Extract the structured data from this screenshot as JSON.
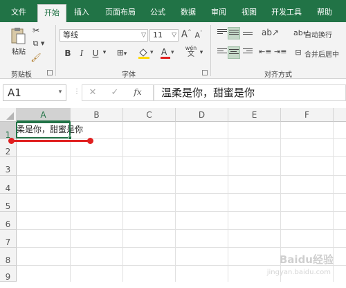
{
  "tabs": [
    {
      "label": "文件",
      "active": false
    },
    {
      "label": "开始",
      "active": true
    },
    {
      "label": "插入",
      "active": false
    },
    {
      "label": "页面布局",
      "active": false
    },
    {
      "label": "公式",
      "active": false
    },
    {
      "label": "数据",
      "active": false
    },
    {
      "label": "审阅",
      "active": false
    },
    {
      "label": "视图",
      "active": false
    },
    {
      "label": "开发工具",
      "active": false
    },
    {
      "label": "帮助",
      "active": false
    }
  ],
  "ribbon": {
    "clipboard": {
      "paste_label": "粘贴",
      "group_label": "剪贴板"
    },
    "font": {
      "font_name": "等线",
      "font_size": "11",
      "group_label": "字体",
      "bold": "B",
      "italic": "I",
      "underline": "U",
      "grow": "A",
      "shrink": "A",
      "phonetic_top": "wén",
      "phonetic_bottom": "文"
    },
    "alignment": {
      "wrap_text": "自动换行",
      "merge_center": "合并后居中",
      "group_label": "对齐方式"
    }
  },
  "formula_bar": {
    "name_box": "A1",
    "fx": "fx",
    "content": "温柔是你，甜蜜是你"
  },
  "sheet": {
    "columns": [
      "A",
      "B",
      "C",
      "D",
      "E",
      "F"
    ],
    "rows": [
      "1",
      "2",
      "3",
      "4",
      "5",
      "6",
      "7",
      "8",
      "9"
    ],
    "selected_cell": "A1",
    "cell_a1_visible": "柔是你，甜蜜是你"
  },
  "watermark": {
    "text": "Baidu经验",
    "url": "jingyan.baidu.com"
  },
  "colors": {
    "accent": "#217346",
    "annotation": "#e02020"
  }
}
